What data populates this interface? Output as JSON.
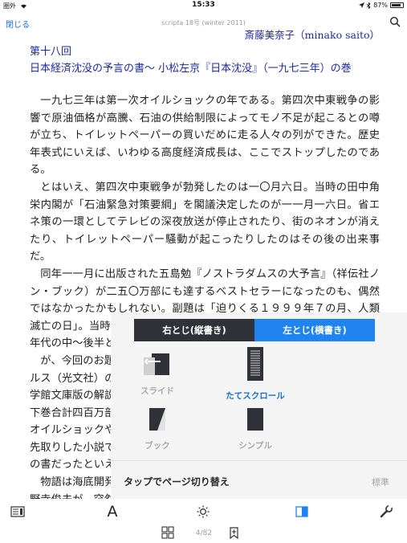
{
  "status": {
    "carrier": "圏外",
    "wifi_icon": "wifi-icon",
    "time": "15:33",
    "battery_percent": "87%",
    "battery_level": 0.87
  },
  "nav": {
    "close_label": "閉じる",
    "title": "scripta 18号 (winter 2011)",
    "search_icon": "search-icon"
  },
  "article": {
    "author": "斎藤美奈子（minako saito）",
    "chapter": "第十八回",
    "title": "日本経済沈没の予言の書〜 小松左京『日本沈没』（一九七三年）の巻",
    "paragraphs": [
      "一九七三年は第一次オイルショックの年である。第四次中東戦争の影響で原油価格が高騰、石油の供給制限によってモノ不足が起こるとの噂が立ち、トイレットペーパーの買いだめに走る人々の列ができた。歴史年表式にいえば、いわゆる高度経済成長は、ここでストップしたのである。",
      "とはいえ、第四次中東戦争が勃発したのは一〇月六日。当時の田中角栄内閣が「石油緊急対策要綱」を閣議決定したのが一一月一六日。省エネ策の一環としてテレビの深夜放送が停止されたり、街のネオンが消えたり、トイレットペーパー騒動が起こったりしたのはその後の出来事だ。",
      "同年一一月に出版された五島勉『ノストラダムスの大予言』（祥伝社ノン・ブック）が二五〇万部にも達するベストセラーになったのも、偶然ではなかったかもしれない。副題は「迫りくる１９９９年７の月、人類滅亡の日」。当時の小学生や中学生には相当なインパクトを与えた。七〇年代の中〜後半という",
      "が、今回のお題",
      "ルス（光文社）の",
      "学館文庫版の解説",
      "下巻合計四百万部",
      "オイルショックや",
      "先取りした小説で",
      "の書だったといえ",
      "物語は海底開発",
      "野寺俊夫が、突然"
    ]
  },
  "settings": {
    "binding_right": "右とじ(縦書き)",
    "binding_left": "左とじ(横書き)",
    "selected_binding": "left",
    "modes": [
      {
        "label": "スライド",
        "icon": "slide-mode-icon",
        "active": false
      },
      {
        "label": "たてスクロール",
        "icon": "vertical-scroll-icon",
        "active": true
      },
      {
        "label": "ブック",
        "icon": "book-mode-icon",
        "active": false
      },
      {
        "label": "シンプル",
        "icon": "simple-mode-icon",
        "active": false
      }
    ],
    "tap_label": "タップでページ切り替え",
    "tap_value": "標準"
  },
  "toolbar": {
    "font_glyph": "A",
    "page_indicator": "4/82",
    "icons": [
      "toc-icon",
      "font-icon",
      "brightness-icon",
      "layout-icon",
      "settings-wrench-icon",
      "thumbnails-icon",
      "bookmark-add-icon"
    ]
  },
  "colors": {
    "accent": "#1f84ef",
    "heading_blue": "#1e2aa0",
    "segment_dark": "#2f3238",
    "popover_bg": "#f4f4f4"
  }
}
